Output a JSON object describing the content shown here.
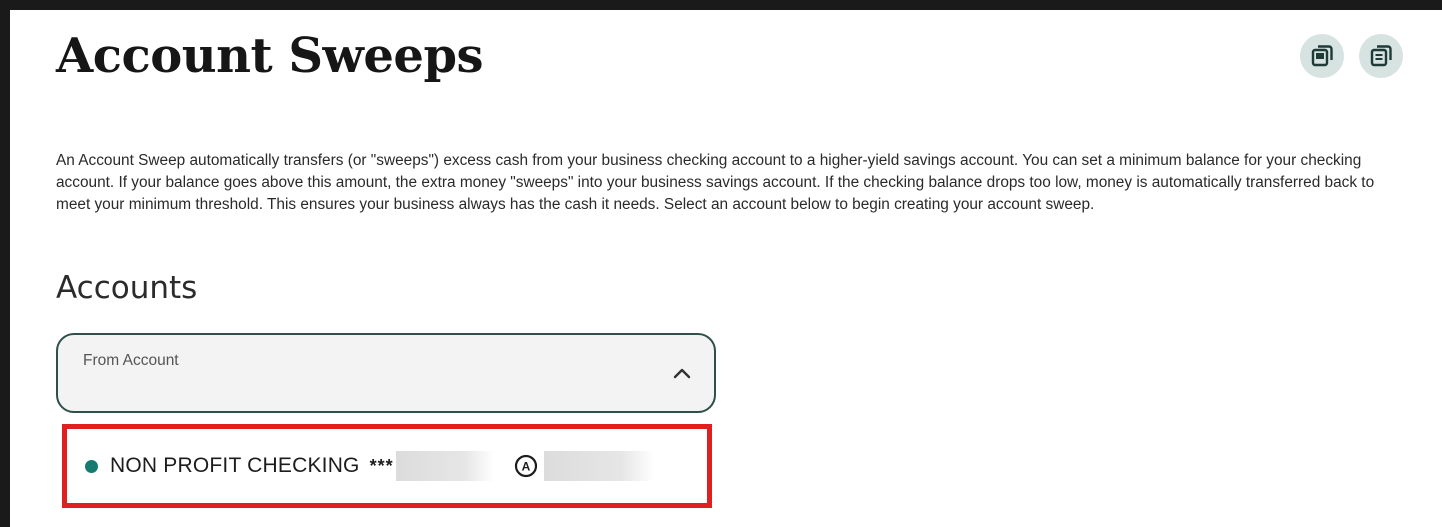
{
  "header": {
    "title": "Account Sweeps",
    "actions": [
      {
        "icon": "copy-window-icon"
      },
      {
        "icon": "document-copy-icon"
      }
    ]
  },
  "intro": {
    "text": "An Account Sweep automatically transfers (or \"sweeps\") excess cash from your business checking account to a higher-yield savings account. You can set a minimum balance for your checking account. If your balance goes above this amount, the extra money \"sweeps\" into your business savings account. If the checking balance drops too low, money is automatically transferred back to meet your minimum threshold. This ensures your business always has the cash it needs. Select an account below to begin creating your account sweep."
  },
  "accounts": {
    "title": "Accounts",
    "from_account": {
      "label": "From Account",
      "expanded": true
    },
    "options": [
      {
        "name": "NON PROFIT CHECKING",
        "mask": "***",
        "available_icon_letter": "A"
      }
    ]
  },
  "colors": {
    "accent": "#177a70",
    "select_border": "#2f4f4b",
    "highlight": "#e02020",
    "icon_button_bg": "#d6e3e1"
  }
}
